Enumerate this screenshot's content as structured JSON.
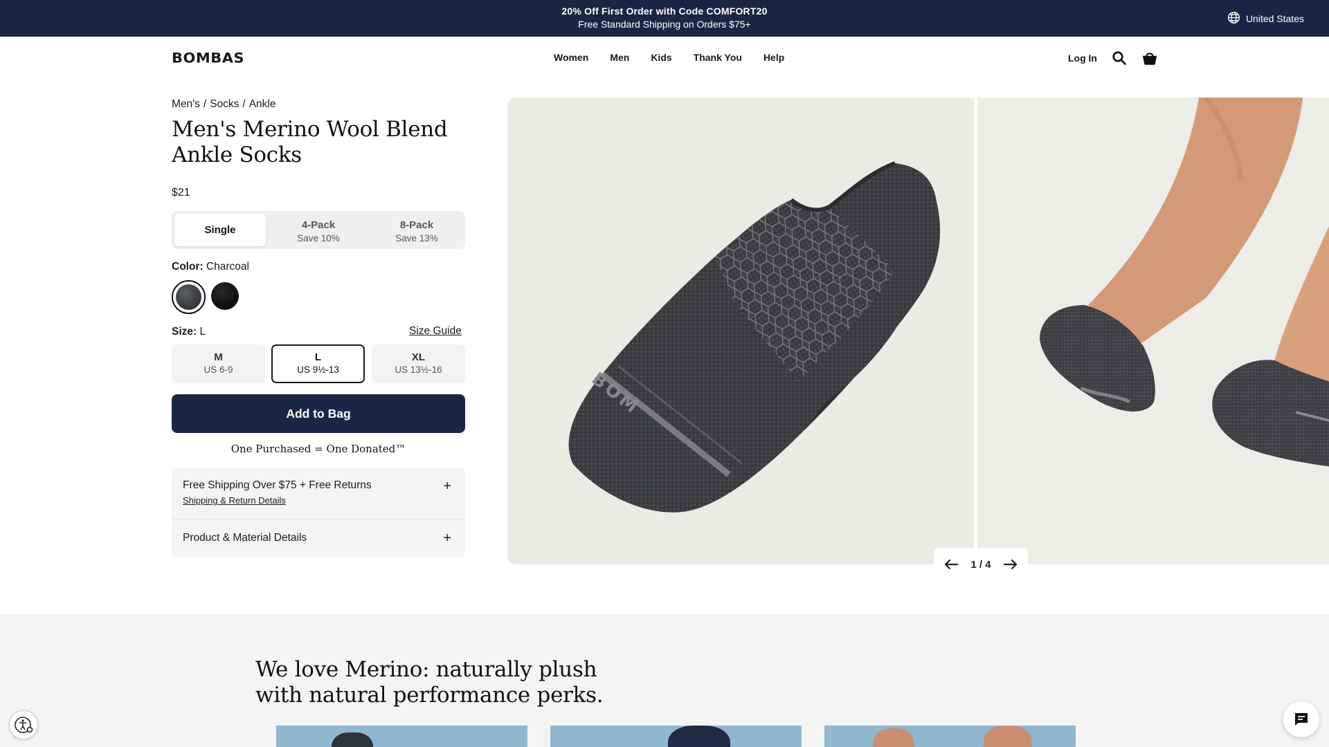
{
  "promo": {
    "line1": "20% Off First Order with Code COMFORT20",
    "line2": "Free Standard Shipping on Orders $75+",
    "region": "United States",
    "region_icon": "globe-icon"
  },
  "header": {
    "logo": "BOMBAS",
    "nav": [
      "Women",
      "Men",
      "Kids",
      "Thank You",
      "Help"
    ],
    "login": "Log In",
    "icons": [
      "search-icon",
      "bag-icon"
    ]
  },
  "product": {
    "breadcrumb": [
      "Men's",
      "Socks",
      "Ankle"
    ],
    "breadcrumb_sep": "/",
    "title": "Men's Merino Wool Blend Ankle Socks",
    "price": "$21",
    "packs": [
      {
        "name": "Single",
        "save": ""
      },
      {
        "name": "4-Pack",
        "save": "Save 10%"
      },
      {
        "name": "8-Pack",
        "save": "Save 13%"
      }
    ],
    "selected_pack": "Single",
    "color_label": "Color:",
    "color_value": "Charcoal",
    "swatches": [
      {
        "name": "Charcoal",
        "color": "#3f4245",
        "selected": true
      },
      {
        "name": "Black",
        "color": "#111111",
        "selected": false
      }
    ],
    "size_label": "Size:",
    "size_value": "L",
    "size_guide": "Size Guide",
    "sizes": [
      {
        "name": "M",
        "range": "US 6-9"
      },
      {
        "name": "L",
        "range": "US 9½-13"
      },
      {
        "name": "XL",
        "range": "US 13½-16"
      }
    ],
    "selected_size": "L",
    "add_to_bag": "Add to Bag",
    "donated": "One Purchased = One Donated™",
    "accordion": [
      {
        "title": "Free Shipping Over $75 + Free Returns",
        "link": "Shipping & Return Details",
        "icon": "+"
      },
      {
        "title": "Product & Material Details",
        "icon": "+"
      }
    ]
  },
  "gallery": {
    "counter": "1 / 4",
    "prev_icon": "arrow-left-icon",
    "next_icon": "arrow-right-icon"
  },
  "section": {
    "heading": "We love Merino: naturally plush with natural performance perks."
  },
  "widgets": {
    "accessibility_icon": "accessibility-icon",
    "chat_icon": "chat-icon"
  },
  "colors": {
    "navy": "#1b2644",
    "panel": "#f4f4f2",
    "image_bg": "#ebebe6"
  }
}
